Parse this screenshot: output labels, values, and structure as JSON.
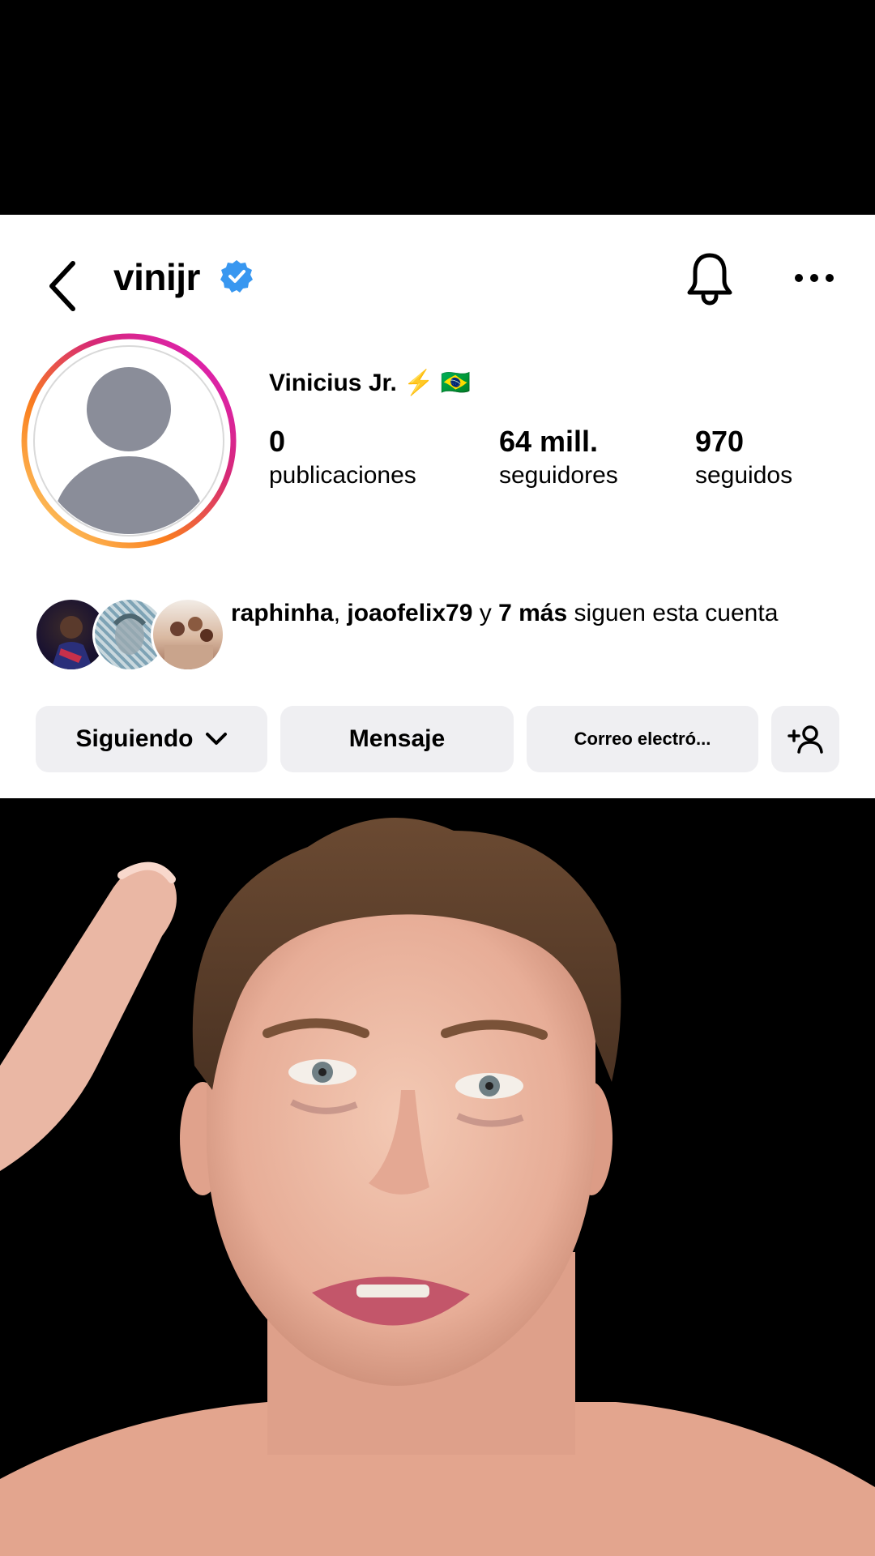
{
  "profile": {
    "username": "vinijr",
    "display_name": "Vinicius Jr.",
    "name_emojis": "⚡ 🇧🇷",
    "stats": [
      {
        "value": "0",
        "label": "publicaciones"
      },
      {
        "value": "64 mill.",
        "label": "seguidores"
      },
      {
        "value": "970",
        "label": "seguidos"
      }
    ],
    "mutual": {
      "user1": "raphinha",
      "sep": ", ",
      "user2": "joaofelix79",
      "mid": " y ",
      "more": "7 más",
      "tail": " siguen esta cuenta"
    }
  },
  "actions": {
    "following": "Siguiendo",
    "message": "Mensaje",
    "email": "Correo electró..."
  },
  "colors": {
    "verified": "#3897f0",
    "button_bg": "#efeff2",
    "avatar_placeholder": "#8a8d99"
  },
  "icons": [
    "back-arrow-icon",
    "verified-badge-icon",
    "bell-icon",
    "more-options-icon",
    "chevron-down-icon",
    "add-person-icon"
  ]
}
